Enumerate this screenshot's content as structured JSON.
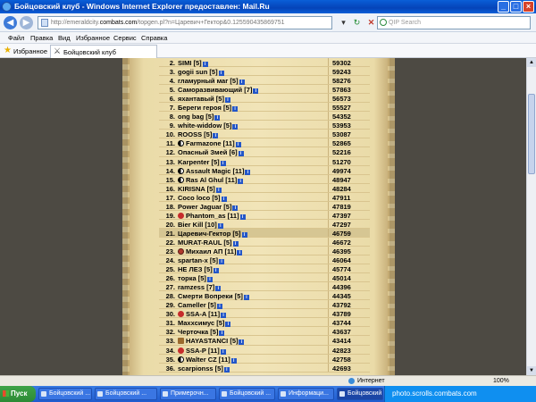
{
  "window": {
    "title": "Бойцовский клуб - Windows Internet Explorer предоставлен: Mail.Ru",
    "min": "_",
    "max": "□",
    "close": "×"
  },
  "toolbar": {
    "address_prefix": "http://emeraldcity.",
    "address_domain": "combats.com",
    "address_suffix": "/topgen.pl?n=Царевич+Гектор&0.125590435869751",
    "search_placeholder": "QIP Search"
  },
  "menu": [
    "Файл",
    "Правка",
    "Вид",
    "Избранное",
    "Сервис",
    "Справка"
  ],
  "favorites": {
    "label": "Избранное",
    "tab_title": "Бойцовский клуб"
  },
  "ranking": [
    {
      "rank": "2.",
      "name": "SIMI [5]",
      "points": "59302",
      "icon": ""
    },
    {
      "rank": "3.",
      "name": "gogii sun [5]",
      "points": "59243",
      "icon": ""
    },
    {
      "rank": "4.",
      "name": "гламурный маг [5]",
      "points": "58276",
      "icon": ""
    },
    {
      "rank": "5.",
      "name": "Саморазвивающий [7]",
      "points": "57863",
      "icon": ""
    },
    {
      "rank": "6.",
      "name": "яхантавый [5]",
      "points": "56573",
      "icon": ""
    },
    {
      "rank": "7.",
      "name": "Береги героя [5]",
      "points": "55527",
      "icon": ""
    },
    {
      "rank": "8.",
      "name": "ong bag [5]",
      "points": "54352",
      "icon": ""
    },
    {
      "rank": "9.",
      "name": "white-widdow [5]",
      "points": "53953",
      "icon": ""
    },
    {
      "rank": "10.",
      "name": "ROOSS [5]",
      "points": "53087",
      "icon": ""
    },
    {
      "rank": "11.",
      "name": "Farmazone [11]",
      "points": "52865",
      "icon": "yy"
    },
    {
      "rank": "12.",
      "name": "Опасный Змей [6]",
      "points": "52216",
      "icon": ""
    },
    {
      "rank": "13.",
      "name": "Karpenter [5]",
      "points": "51270",
      "icon": ""
    },
    {
      "rank": "14.",
      "name": "Assault Magic [11]",
      "points": "49974",
      "icon": "yy"
    },
    {
      "rank": "15.",
      "name": "Ras Al Ghul [11]",
      "points": "48947",
      "icon": "yy"
    },
    {
      "rank": "16.",
      "name": "KIRISNA [5]",
      "points": "48284",
      "icon": ""
    },
    {
      "rank": "17.",
      "name": "Coco loco [5]",
      "points": "47911",
      "icon": ""
    },
    {
      "rank": "18.",
      "name": "Power Jaguar [5]",
      "points": "47819",
      "icon": ""
    },
    {
      "rank": "19.",
      "name": "Phantom_as [11]",
      "points": "47397",
      "icon": "cross"
    },
    {
      "rank": "20.",
      "name": "Bier Kill [10]",
      "points": "47297",
      "icon": ""
    },
    {
      "rank": "21.",
      "name": "Царевич-Гектор [5]",
      "points": "46759",
      "icon": "",
      "highlight": true
    },
    {
      "rank": "22.",
      "name": "MURAT-RAUL [5]",
      "points": "46672",
      "icon": ""
    },
    {
      "rank": "23.",
      "name": "Михаил АП [11]",
      "points": "46395",
      "icon": "cross-badge"
    },
    {
      "rank": "24.",
      "name": "spartan-x [5]",
      "points": "46064",
      "icon": ""
    },
    {
      "rank": "25.",
      "name": "НЕ ЛЕЗ [5]",
      "points": "45774",
      "icon": ""
    },
    {
      "rank": "26.",
      "name": "торка [5]",
      "points": "45014",
      "icon": ""
    },
    {
      "rank": "27.",
      "name": "ramzess [7]",
      "points": "44396",
      "icon": ""
    },
    {
      "rank": "28.",
      "name": "Смерти Вопреки [5]",
      "points": "44345",
      "icon": ""
    },
    {
      "rank": "29.",
      "name": "Cameller [5]",
      "points": "43792",
      "icon": ""
    },
    {
      "rank": "30.",
      "name": "SSA-A [11]",
      "points": "43789",
      "icon": "cross"
    },
    {
      "rank": "31.",
      "name": "Maxxсимус [5]",
      "points": "43744",
      "icon": ""
    },
    {
      "rank": "32.",
      "name": "Черточка [5]",
      "points": "43637",
      "icon": ""
    },
    {
      "rank": "33.",
      "name": "HAYASTANCI [5]",
      "points": "43414",
      "icon": "shield"
    },
    {
      "rank": "34.",
      "name": "SSA-P [11]",
      "points": "42823",
      "icon": "cross"
    },
    {
      "rank": "35.",
      "name": "Walter CZ [11]",
      "points": "42758",
      "icon": "yy"
    },
    {
      "rank": "36.",
      "name": "scarpionss [5]",
      "points": "42693",
      "icon": ""
    }
  ],
  "statusbar": {
    "zone": "Интернет",
    "zoom": "100%"
  },
  "taskbar": {
    "start": "Пуск",
    "items": [
      "Бойцовский ...",
      "Бойцовский ...",
      "Примерочн...",
      "Бойцовский ...",
      "Информаци...",
      "Бойцовский ..."
    ],
    "tray_text": "photo.scrolls.combats.com"
  }
}
